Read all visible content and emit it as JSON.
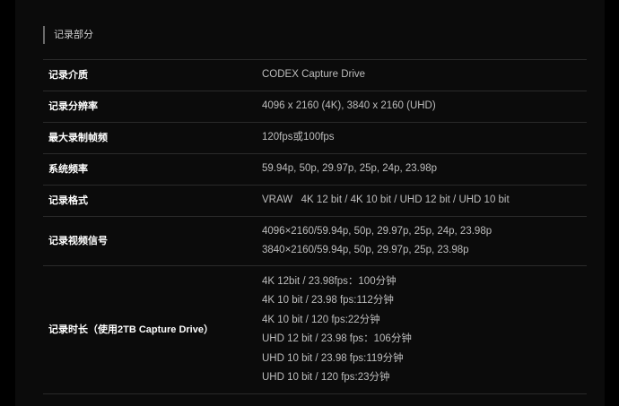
{
  "section": {
    "title": "记录部分"
  },
  "rows": [
    {
      "label": "记录介质",
      "values": [
        "CODEX Capture Drive"
      ]
    },
    {
      "label": "记录分辨率",
      "values": [
        "4096 x 2160 (4K), 3840 x 2160 (UHD)"
      ]
    },
    {
      "label": "最大录制帧频",
      "values": [
        "120fps或100fps"
      ]
    },
    {
      "label": "系统频率",
      "values": [
        "59.94p, 50p, 29.97p, 25p, 24p, 23.98p"
      ]
    },
    {
      "label": "记录格式",
      "values": [
        "VRAW   4K 12 bit / 4K 10 bit / UHD 12 bit / UHD 10 bit"
      ]
    },
    {
      "label": "记录视频信号",
      "values": [
        "4096×2160/59.94p, 50p, 29.97p, 25p, 24p, 23.98p",
        "3840×2160/59.94p, 50p, 29.97p, 25p, 23.98p"
      ]
    },
    {
      "label": "记录时长（使用2TB Capture Drive）",
      "values": [
        "4K 12bit / 23.98fps：100分钟",
        "4K 10 bit / 23.98 fps:112分钟",
        "4K 10 bit / 120 fps:22分钟",
        "UHD 12 bit / 23.98 fps：106分钟",
        "UHD 10 bit / 23.98 fps:119分钟",
        "UHD 10 bit / 120 fps:23分钟"
      ]
    }
  ]
}
